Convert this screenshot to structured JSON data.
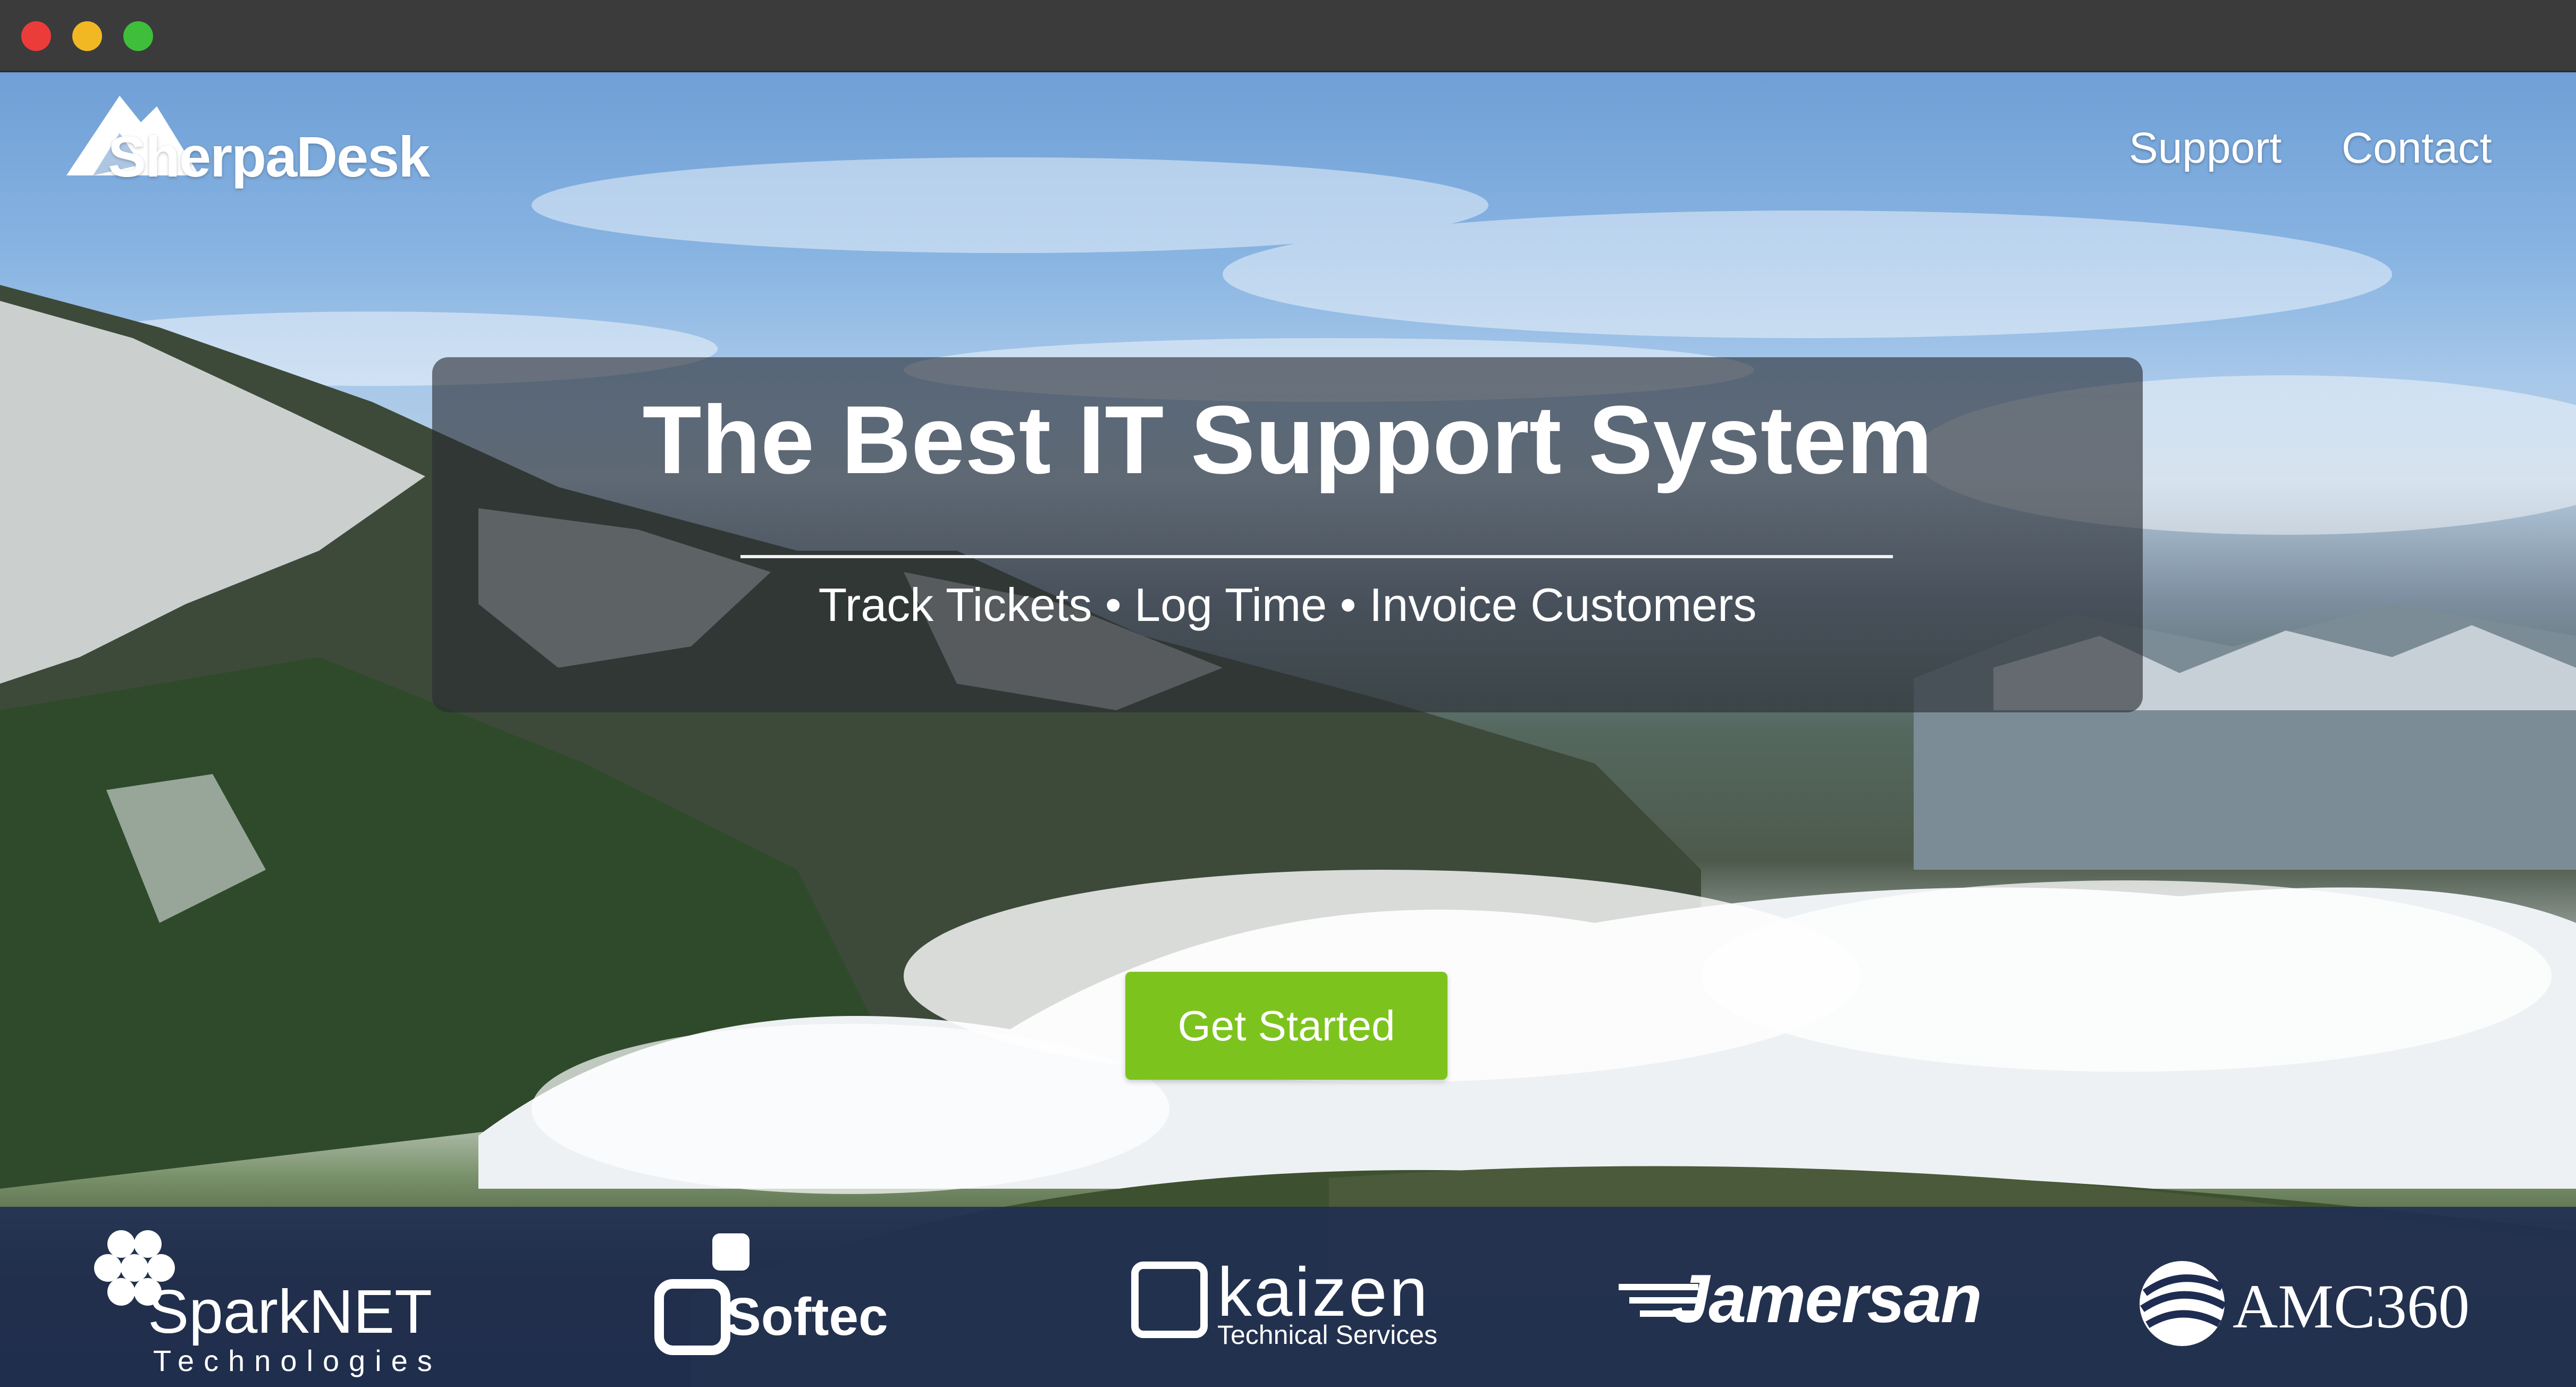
{
  "brand": {
    "logo_text": "SherpaDesk"
  },
  "nav": {
    "support": "Support",
    "contact": "Contact"
  },
  "hero": {
    "headline": "The Best IT Support System",
    "subline": "Track Tickets • Log Time • Invoice Customers",
    "cta": "Get Started"
  },
  "clients": [
    {
      "name": "SparkNET",
      "sub": "Technologies"
    },
    {
      "name": "Softec"
    },
    {
      "name": "kaizen",
      "sub": "Technical Services"
    },
    {
      "name": "Jamersan"
    },
    {
      "name": "AMC360"
    }
  ],
  "colors": {
    "cta": "#7dc31e",
    "band": "#1f2c52",
    "panel": "#282c32"
  }
}
